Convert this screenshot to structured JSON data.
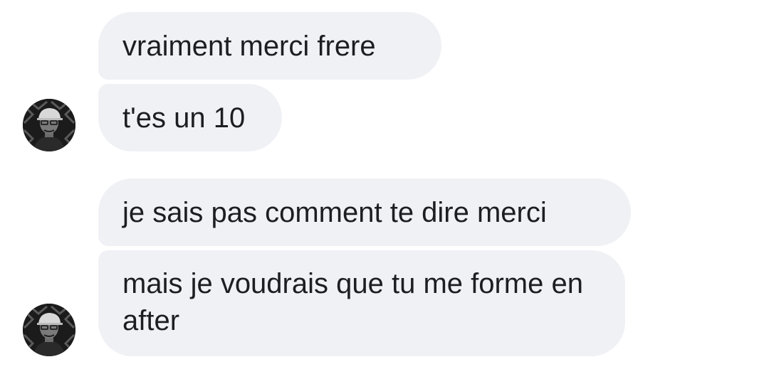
{
  "conversation": {
    "messages": [
      {
        "text": "vraiment merci frere"
      },
      {
        "text": "t'es un 10"
      },
      {
        "text": "je sais pas comment te dire merci"
      },
      {
        "text": "mais je voudrais que tu me forme en after"
      }
    ],
    "bubble_color": "#f0f1f5",
    "text_color": "#1c1e21",
    "background_color": "#ffffff"
  }
}
